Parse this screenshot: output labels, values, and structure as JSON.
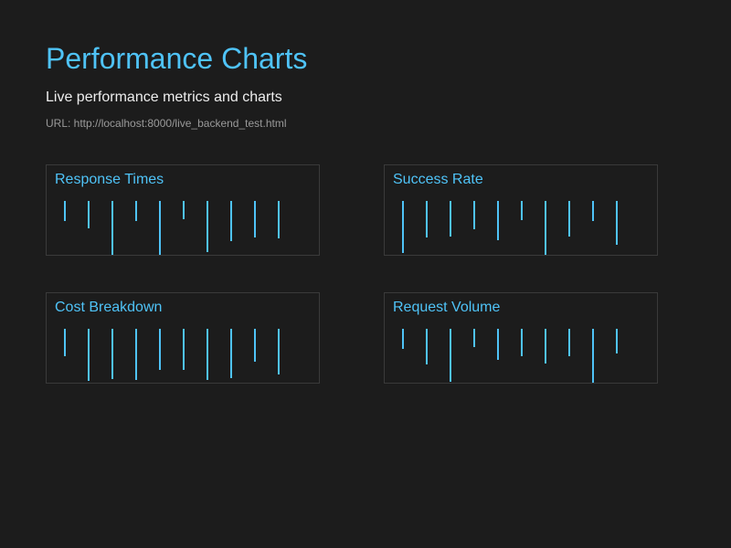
{
  "header": {
    "title": "Performance Charts",
    "subtitle": "Live performance metrics and charts",
    "url_text": "URL: http://localhost:8000/live_backend_test.html"
  },
  "colors": {
    "background": "#1c1c1c",
    "accent": "#4fc3f7",
    "border": "#3a3a3a",
    "text": "#ededed",
    "muted": "#9a9a9a"
  },
  "chart_data": [
    {
      "type": "bar",
      "title": "Response Times",
      "series": [
        {
          "values": [
            22,
            30,
            59,
            22,
            60,
            20,
            56,
            44,
            40,
            41
          ]
        }
      ]
    },
    {
      "type": "bar",
      "title": "Success Rate",
      "series": [
        {
          "values": [
            57,
            40,
            39,
            31,
            43,
            21,
            60,
            39,
            22,
            48
          ]
        }
      ]
    },
    {
      "type": "bar",
      "title": "Cost Breakdown",
      "series": [
        {
          "values": [
            30,
            57,
            55,
            56,
            45,
            45,
            56,
            54,
            36,
            50
          ]
        }
      ]
    },
    {
      "type": "bar",
      "title": "Request Volume",
      "series": [
        {
          "values": [
            22,
            39,
            58,
            20,
            34,
            30,
            38,
            30,
            60,
            27
          ]
        }
      ]
    }
  ]
}
